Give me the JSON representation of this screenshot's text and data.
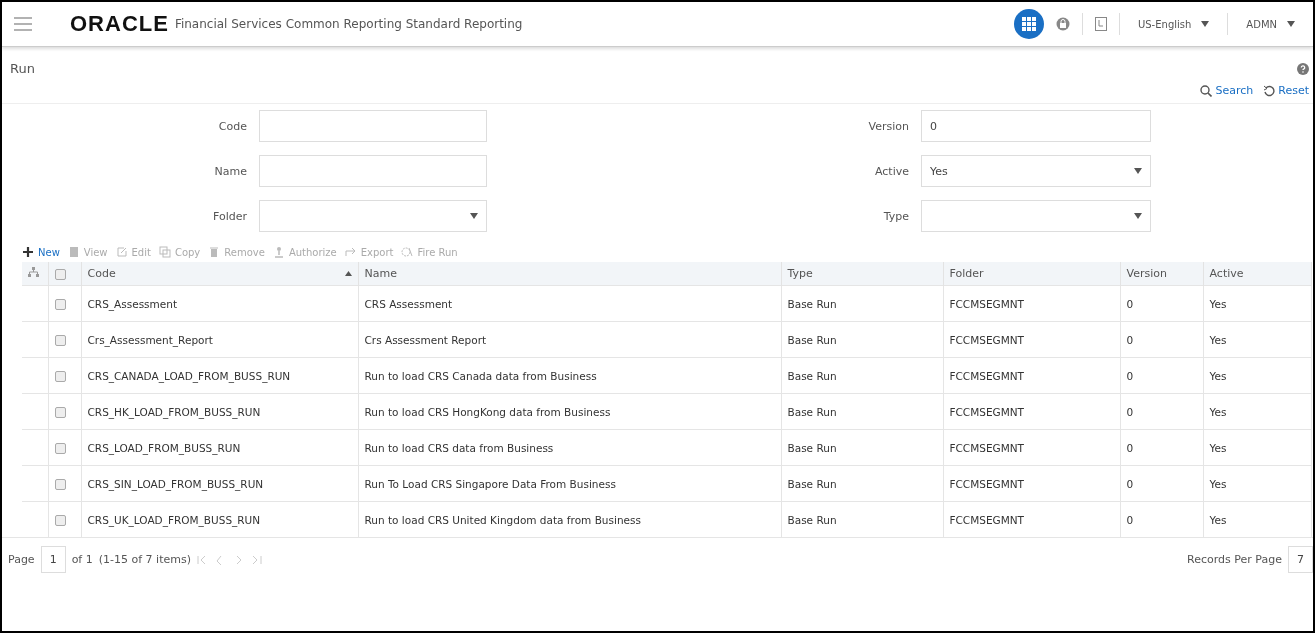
{
  "header": {
    "logo": "ORACLE",
    "title": "Financial Services Common Reporting Standard Reporting",
    "language": "US-English",
    "user": "ADMN"
  },
  "page_title": "Run",
  "search_actions": [
    "Search",
    "Reset"
  ],
  "filters": [
    {
      "label": "Code",
      "kind": "text"
    },
    {
      "label": "Version",
      "kind": "text",
      "value": "0"
    },
    {
      "label": "Name",
      "kind": "text"
    },
    {
      "label": "Active",
      "kind": "select",
      "value": "Yes"
    },
    {
      "label": "Folder",
      "kind": "select"
    },
    {
      "label": "Type",
      "kind": "select"
    }
  ],
  "toolbar": [
    {
      "label": "New",
      "disabled": false
    },
    {
      "label": "View",
      "disabled": true
    },
    {
      "label": "Edit",
      "disabled": true
    },
    {
      "label": "Copy",
      "disabled": true
    },
    {
      "label": "Remove",
      "disabled": true
    },
    {
      "label": "Authorize",
      "disabled": true
    },
    {
      "label": "Export",
      "disabled": true
    },
    {
      "label": "Fire Run",
      "disabled": true
    }
  ],
  "table": {
    "all_selected": false,
    "columns": [
      "Code",
      "Name",
      "Type",
      "Folder",
      "Version",
      "Active"
    ],
    "rows": [
      {
        "selected": false,
        "cells": [
          "CRS_Assessment",
          "CRS Assessment",
          "Base Run",
          "FCCMSEGMNT",
          "0",
          "Yes"
        ]
      },
      {
        "selected": false,
        "cells": [
          "Crs_Assessment_Report",
          "Crs Assessment Report",
          "Base Run",
          "FCCMSEGMNT",
          "0",
          "Yes"
        ]
      },
      {
        "selected": false,
        "cells": [
          "CRS_CANADA_LOAD_FROM_BUSS_RUN",
          "Run to load CRS Canada data from Business",
          "Base Run",
          "FCCMSEGMNT",
          "0",
          "Yes"
        ]
      },
      {
        "selected": false,
        "cells": [
          "CRS_HK_LOAD_FROM_BUSS_RUN",
          "Run to load CRS HongKong data from Business",
          "Base Run",
          "FCCMSEGMNT",
          "0",
          "Yes"
        ]
      },
      {
        "selected": false,
        "cells": [
          "CRS_LOAD_FROM_BUSS_RUN",
          "Run to load CRS data from Business",
          "Base Run",
          "FCCMSEGMNT",
          "0",
          "Yes"
        ]
      },
      {
        "selected": false,
        "cells": [
          "CRS_SIN_LOAD_FROM_BUSS_RUN",
          "Run To Load CRS Singapore Data From Business",
          "Base Run",
          "FCCMSEGMNT",
          "0",
          "Yes"
        ]
      },
      {
        "selected": false,
        "cells": [
          "CRS_UK_LOAD_FROM_BUSS_RUN",
          "Run to load CRS United Kingdom data from Business",
          "Base Run",
          "FCCMSEGMNT",
          "0",
          "Yes"
        ]
      }
    ]
  },
  "pager": {
    "label": "Page",
    "page": "1",
    "of": "of 1",
    "range": "(1-15 of  7 items)",
    "records_label": "Records Per Page",
    "records": "7"
  }
}
